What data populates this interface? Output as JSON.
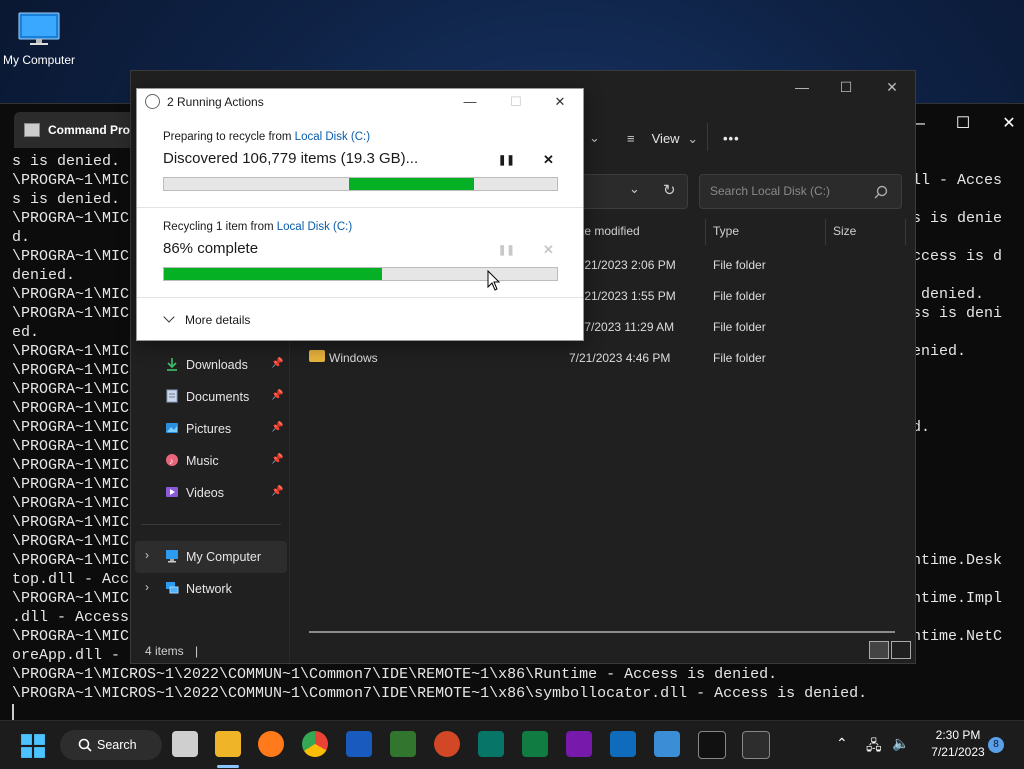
{
  "desktop": {
    "icon_label": "My Computer"
  },
  "cmd": {
    "tab_title": "Command Prompt",
    "controls": {
      "minimize": "—",
      "maximize": "☐",
      "close": "✕"
    },
    "left_lines": [
      "s is denied.",
      "\\PROGRA~1\\MIC",
      "s is denied.",
      "\\PROGRA~1\\MIC",
      "d.",
      "\\PROGRA~1\\MIC",
      "denied.",
      "\\PROGRA~1\\MIC",
      "\\PROGRA~1\\MIC",
      "ed.",
      "\\PROGRA~1\\MIC",
      "\\PROGRA~1\\MIC",
      "\\PROGRA~1\\MIC",
      "\\PROGRA~1\\MIC",
      "\\PROGRA~1\\MIC",
      "\\PROGRA~1\\MIC",
      "\\PROGRA~1\\MIC",
      "\\PROGRA~1\\MIC",
      "\\PROGRA~1\\MIC",
      "\\PROGRA~1\\MIC",
      "\\PROGRA~1\\MIC",
      "\\PROGRA~1\\MIC",
      "top.dll - Acc",
      "\\PROGRA~1\\MIC",
      ".dll - Access",
      "\\PROGRA~1\\MIC",
      "oreApp.dll -"
    ],
    "right_lines": [
      "",
      "ll - Acces",
      "",
      "s is denie",
      "",
      "ccess is d",
      "",
      " denied.",
      "ss is deni",
      "",
      "enied.",
      "",
      "",
      "",
      "d.",
      "",
      "",
      "",
      "",
      "",
      "",
      "ntime.Desk",
      "",
      "ntime.Impl",
      "",
      "ntime.NetC",
      ""
    ],
    "bottom_lines": [
      "\\PROGRA~1\\MICROS~1\\2022\\COMMUN~1\\Common7\\IDE\\REMOTE~1\\x86\\Runtime - Access is denied.",
      "\\PROGRA~1\\MICROS~1\\2022\\COMMUN~1\\Common7\\IDE\\REMOTE~1\\x86\\symbollocator.dll - Access is denied."
    ]
  },
  "explorer": {
    "controls": {
      "minimize": "—",
      "maximize": "☐",
      "close": "✕"
    },
    "toolbar": {
      "view_label": "View",
      "more_label": "•••"
    },
    "search_placeholder": "Search Local Disk (C:)",
    "columns": {
      "date": "te modified",
      "type": "Type",
      "size": "Size"
    },
    "rows": [
      {
        "name": "",
        "date": "/21/2023 2:06 PM",
        "type": "File folder"
      },
      {
        "name": "",
        "date": "/21/2023 1:55 PM",
        "type": "File folder"
      },
      {
        "name": "",
        "date": "/7/2023 11:29 AM",
        "type": "File folder"
      },
      {
        "name": "Windows",
        "date": "7/21/2023 4:46 PM",
        "type": "File folder"
      }
    ],
    "nav": [
      {
        "label": "Downloads",
        "icon": "download-icon"
      },
      {
        "label": "Documents",
        "icon": "documents-icon"
      },
      {
        "label": "Pictures",
        "icon": "pictures-icon"
      },
      {
        "label": "Music",
        "icon": "music-icon"
      },
      {
        "label": "Videos",
        "icon": "videos-icon"
      }
    ],
    "tree": [
      {
        "label": "My Computer",
        "icon": "computer-icon"
      },
      {
        "label": "Network",
        "icon": "network-icon"
      }
    ],
    "status": "4 items",
    "status_sep": "|"
  },
  "dialog": {
    "title": "2 Running Actions",
    "op1": {
      "prefix": "Preparing to recycle from ",
      "link": "Local Disk (C:)",
      "main": "Discovered 106,779 items (19.3 GB)...",
      "progress_start": 0.47,
      "progress_end": 0.79
    },
    "op2": {
      "prefix": "Recycling 1 item from ",
      "link": "Local Disk (C:)",
      "main": "86% complete",
      "progress": 0.555
    },
    "more_details": "More details",
    "controls": {
      "minimize": "—",
      "maximize": "☐",
      "close": "✕"
    }
  },
  "taskbar": {
    "search_label": "Search",
    "time": "2:30 PM",
    "date": "7/21/2023",
    "notification_count": "8",
    "colors": {
      "accent": "#06b025",
      "taskbar": "#1c1c1c"
    }
  }
}
